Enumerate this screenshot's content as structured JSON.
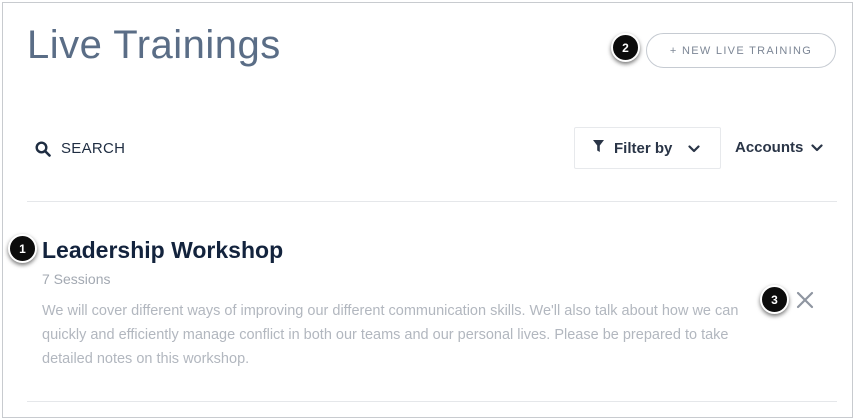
{
  "header": {
    "title": "Live Trainings",
    "new_button_label": "+ NEW LIVE TRAINING"
  },
  "toolbar": {
    "search_label": "SEARCH",
    "filter_label": "Filter by",
    "accounts_label": "Accounts"
  },
  "trainings": [
    {
      "title": "Leadership Workshop",
      "sessions": "7 Sessions",
      "description": "We will cover different ways of improving our different communication skills. We'll also talk about how we can quickly and efficiently manage conflict in both our teams and our personal lives. Please be prepared to take detailed notes on this workshop."
    }
  ],
  "callouts": [
    "1",
    "2",
    "3"
  ],
  "colors": {
    "title": "#5a6d86",
    "item_title": "#13233d",
    "muted_text": "#b2b7bf",
    "callout_bg": "#0c0c0c"
  },
  "icons": [
    "search-icon",
    "filter-funnel-icon",
    "chevron-down-icon",
    "close-icon"
  ]
}
